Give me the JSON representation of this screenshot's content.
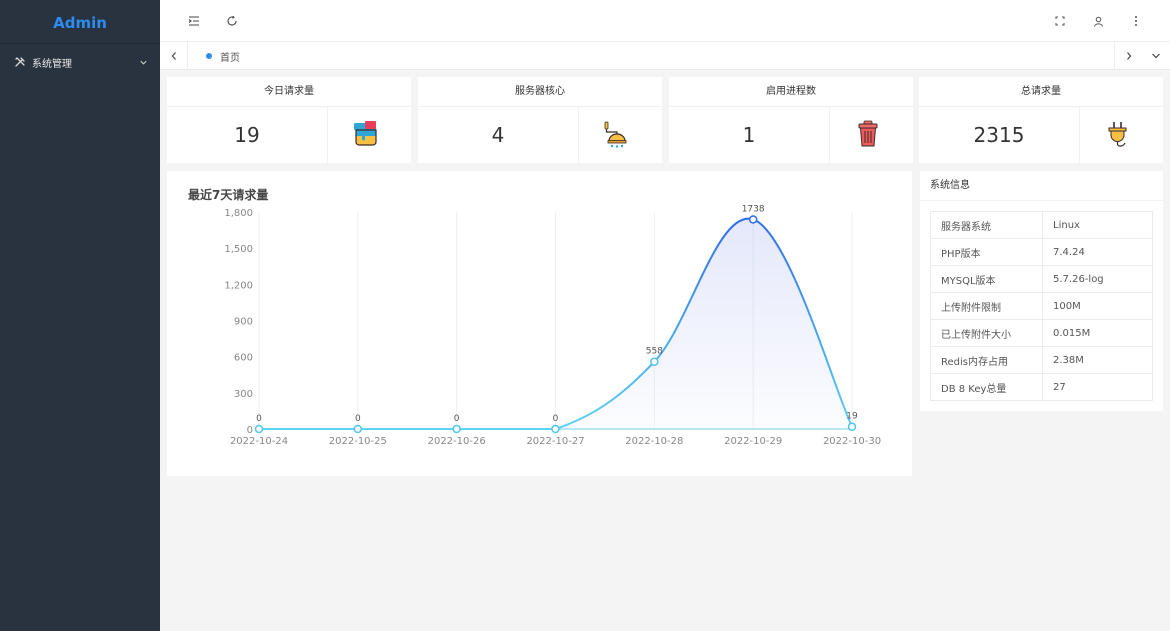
{
  "app": {
    "logo": "Admin"
  },
  "sidebar": {
    "items": [
      {
        "label": "系统管理",
        "icon": "tools-icon"
      }
    ]
  },
  "tabs": [
    {
      "label": "首页",
      "active": true
    }
  ],
  "stats": [
    {
      "title": "今日请求量",
      "value": "19",
      "icon": "paint-bucket-icon"
    },
    {
      "title": "服务器核心",
      "value": "4",
      "icon": "shower-icon"
    },
    {
      "title": "启用进程数",
      "value": "1",
      "icon": "trash-bin-icon"
    },
    {
      "title": "总请求量",
      "value": "2315",
      "icon": "plug-icon"
    }
  ],
  "colors": {
    "sidebar": "#28333f",
    "accent": "#2d8cf0",
    "line_start": "#5fd3f3",
    "line_end": "#2f6fe6"
  },
  "chart_data": {
    "type": "line",
    "title": "最近7天请求量",
    "categories": [
      "2022-10-24",
      "2022-10-25",
      "2022-10-26",
      "2022-10-27",
      "2022-10-28",
      "2022-10-29",
      "2022-10-30"
    ],
    "values": [
      0,
      0,
      0,
      0,
      558,
      1738,
      19
    ],
    "yticks": [
      "0",
      "300",
      "600",
      "900",
      "1,200",
      "1,500",
      "1,800"
    ],
    "ylim": [
      0,
      1800
    ],
    "smooth": true,
    "area": true,
    "grid": "vertical"
  },
  "system_info": {
    "title": "系统信息",
    "rows": [
      {
        "key": "服务器系统",
        "value": "Linux"
      },
      {
        "key": "PHP版本",
        "value": "7.4.24"
      },
      {
        "key": "MYSQL版本",
        "value": "5.7.26-log"
      },
      {
        "key": "上传附件限制",
        "value": "100M"
      },
      {
        "key": "已上传附件大小",
        "value": "0.015M"
      },
      {
        "key": "Redis内存占用",
        "value": "2.38M"
      },
      {
        "key": "DB 8 Key总量",
        "value": "27"
      }
    ]
  }
}
